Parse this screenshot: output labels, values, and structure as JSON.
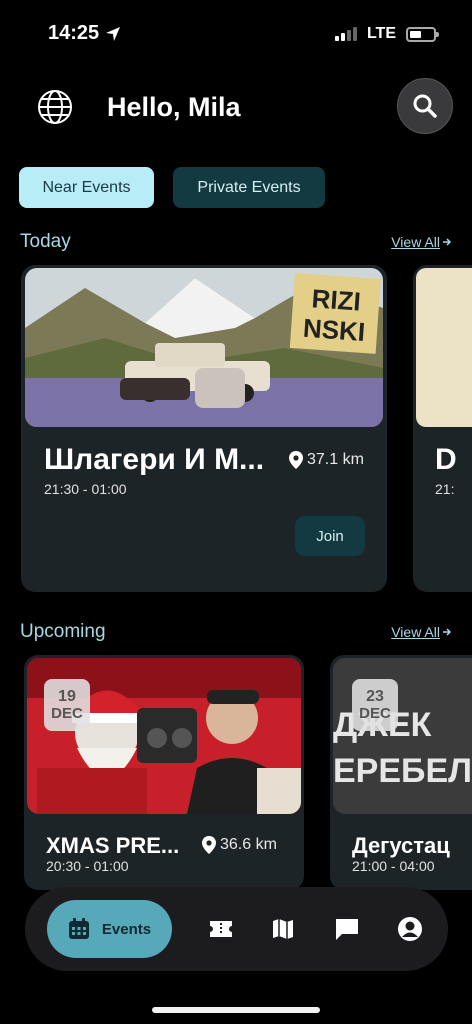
{
  "status": {
    "time": "14:25",
    "network": "LTE"
  },
  "header": {
    "greeting": "Hello, Mila"
  },
  "tabs": [
    {
      "label": "Near Events",
      "active": true
    },
    {
      "label": "Private Events",
      "active": false
    }
  ],
  "today": {
    "title": "Today",
    "view_all": "View All",
    "card": {
      "title": "Шлагери И М...",
      "distance": "37.1 km",
      "time": "21:30 - 01:00",
      "join": "Join",
      "poster_text": "RIZI NSKI"
    },
    "peek": {
      "title": "D",
      "time": "21:"
    }
  },
  "upcoming": {
    "title": "Upcoming",
    "view_all": "View All",
    "cards": [
      {
        "day": "19",
        "month": "DEC",
        "title": "XMAS PRE...",
        "distance": "36.6 km",
        "time": "20:30 - 01:00"
      },
      {
        "day": "23",
        "month": "DEC",
        "title": "Дегустац",
        "time": "21:00 - 04:00",
        "poster_text": "ДЖЕК ЕРЕБЕЛ"
      }
    ]
  },
  "nav": {
    "active_label": "Events",
    "items": [
      "calendar-icon",
      "ticket-icon",
      "map-icon",
      "chat-icon",
      "profile-icon"
    ]
  },
  "colors": {
    "accent": "#b8ecf7",
    "dark_teal": "#123a40",
    "nav_active": "#57a8b8",
    "card_bg": "#1d2427"
  }
}
